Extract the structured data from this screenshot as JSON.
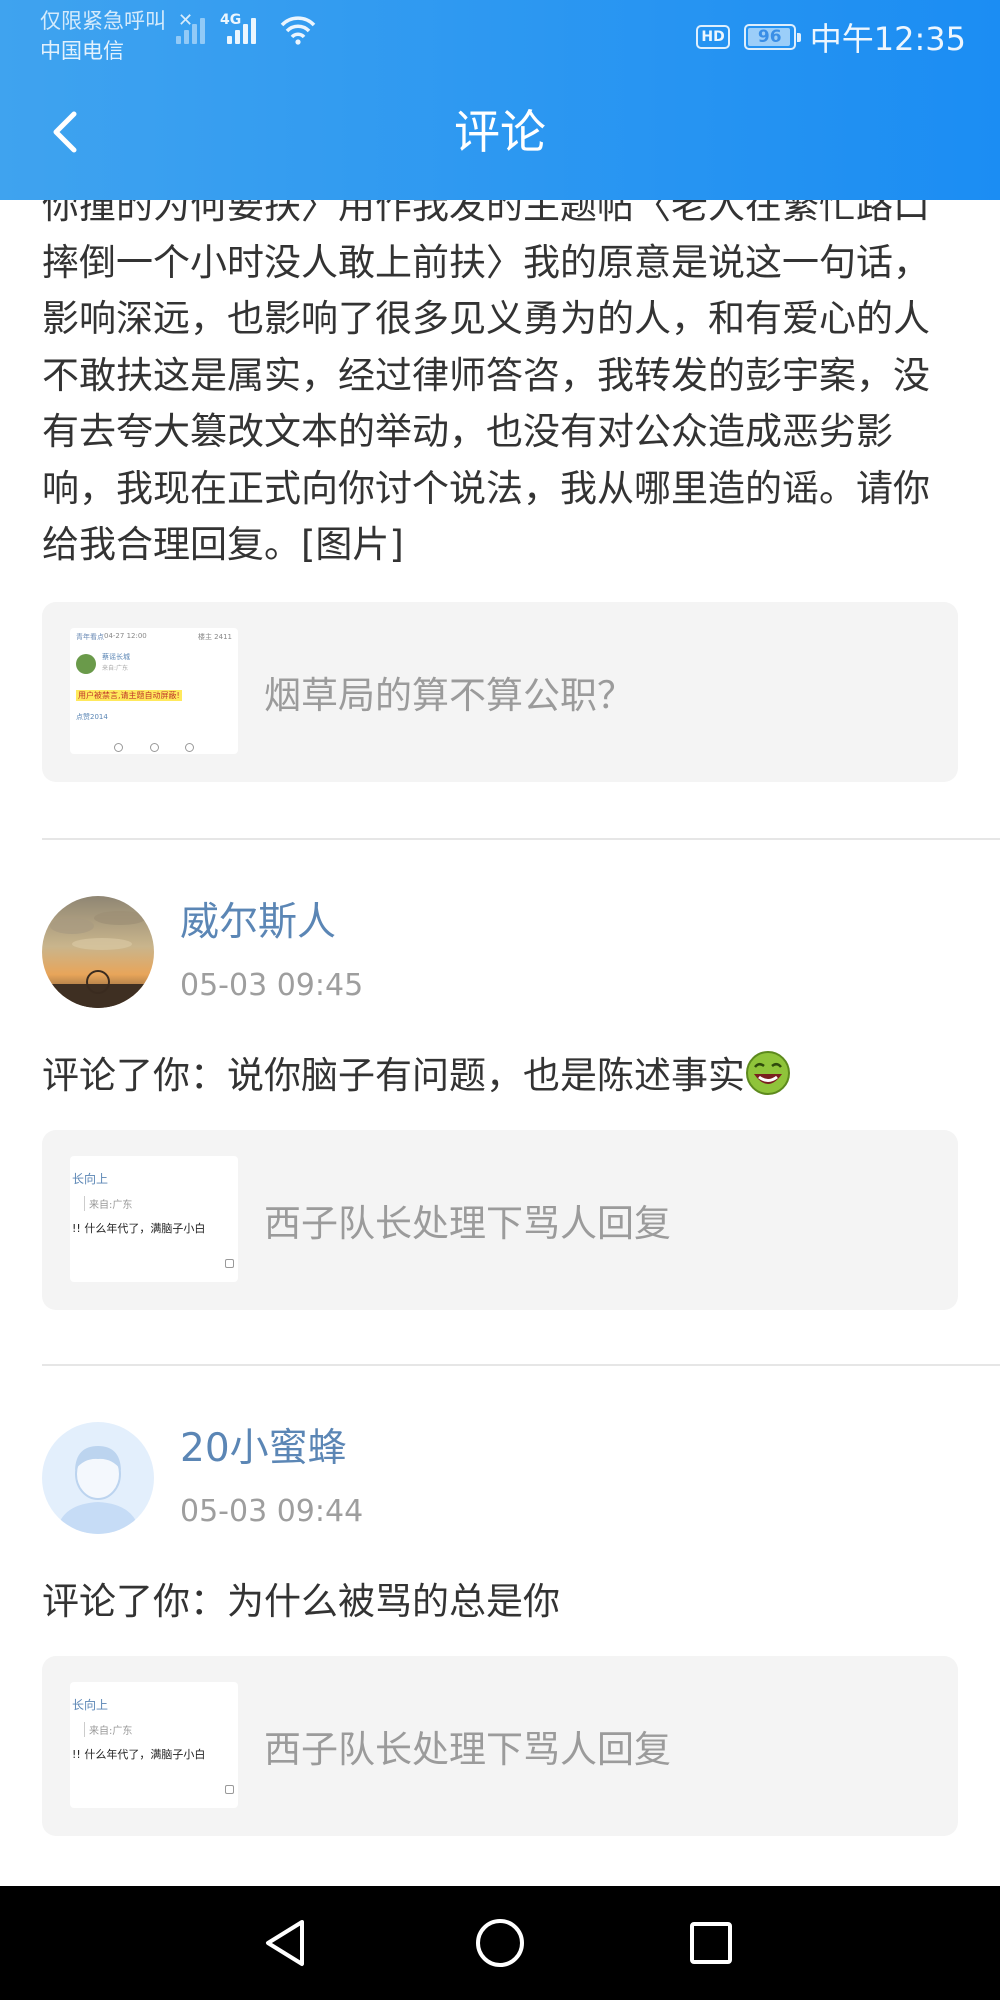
{
  "status_bar": {
    "carrier_line1": "仅限紧急呼叫",
    "carrier_line2": "中国电信",
    "network_type": "4G",
    "hd_badge": "HD",
    "battery_level": "96",
    "battery_fraction": 0.96,
    "clock": "中午12:35"
  },
  "header": {
    "title": "评论"
  },
  "feed": {
    "first_post": {
      "text": "你撞的为何要扶〉用作我发的主题帖〈老人在繁忙路口摔倒一个小时没人敢上前扶〉我的原意是说这一句话，影响深远，也影响了很多见义勇为的人，和有爱心的人不敢扶这是属实，经过律师答咨，我转发的彭宇案，没有去夸大篡改文本的举动，也没有对公众造成恶劣影响，我现在正式向你讨个说法，我从哪里造的谣。请你给我合理回复。[图片]",
      "ref_title": "烟草局的算不算公职？",
      "ref_thumb": {
        "head": "青年看点",
        "date": "04-27 12:00",
        "right": "楼主 2411",
        "name": "蔡谣长城",
        "sub": "来自:广东",
        "highlight": "用户被禁言,请主题自动屏蔽!",
        "likes": "点赞2014"
      }
    },
    "comments": [
      {
        "username": "威尔斯人",
        "timestamp": "05-03 09:45",
        "prefix": "评论了你：",
        "text": "说你脑子有问题，也是陈述事实",
        "emoji": "laugh-emoji",
        "ref_title": "西子队长处理下骂人回复",
        "ref_thumb": {
          "line1": "长向上",
          "line2": "来自:广东",
          "line3": "!! 什么年代了，满脑子小白"
        }
      },
      {
        "username": "20小蜜蜂",
        "timestamp": "05-03 09:44",
        "prefix": "评论了你：",
        "text": "为什么被骂的总是你",
        "ref_title": "西子队长处理下骂人回复",
        "ref_thumb": {
          "line1": "长向上",
          "line2": "来自:广东",
          "line3": "!! 什么年代了，满脑子小白"
        }
      }
    ]
  },
  "colors": {
    "header_start": "#3fa3ef",
    "header_end": "#1b8df3",
    "username": "#5b86b5",
    "card_bg": "#f4f4f4"
  },
  "navbar": {
    "back_icon": "triangle-back-icon",
    "home_icon": "circle-home-icon",
    "recents_icon": "square-recents-icon"
  }
}
